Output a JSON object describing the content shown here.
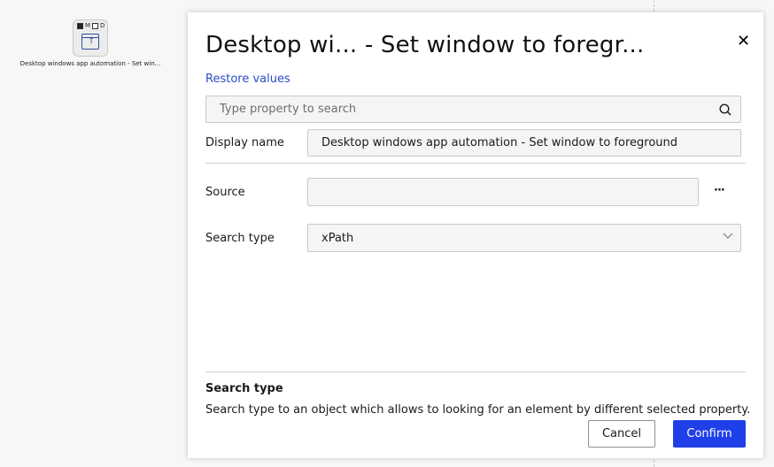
{
  "canvas": {
    "node": {
      "flags": [
        "M",
        "D"
      ],
      "label": "Desktop windows app automation - Set win..."
    }
  },
  "dialog": {
    "title": "Desktop wi... - Set window to foregr...",
    "close_icon": "close-icon",
    "restore_label": "Restore values",
    "search": {
      "placeholder": "Type property to search",
      "value": ""
    },
    "display_name": {
      "label": "Display name",
      "value": "Desktop windows app automation - Set window to foreground"
    },
    "source": {
      "label": "Source",
      "value": "",
      "more_label": "···"
    },
    "search_type": {
      "label": "Search type",
      "value": "xPath"
    },
    "help": {
      "title": "Search type",
      "text": "Search type to an object which allows to looking for an element by different selected property."
    },
    "buttons": {
      "cancel": "Cancel",
      "confirm": "Confirm"
    }
  },
  "colors": {
    "accent": "#1f3fe8",
    "link": "#2a4cc4",
    "panel": "#ffffff",
    "canvas": "#f7f7f7"
  }
}
